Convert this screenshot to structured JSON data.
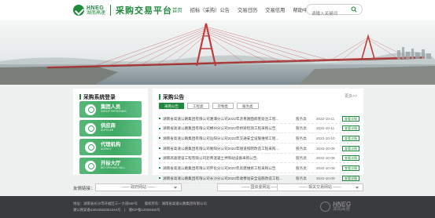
{
  "header": {
    "logo_en": "HNEG",
    "logo_cn": "湖南高速",
    "site_title": "采购交易平台",
    "nav": [
      "首页",
      "招标（采购）公告",
      "交易日历",
      "交易信用",
      "帮助中心"
    ],
    "search_placeholder": "请输入关键词"
  },
  "login_panel": {
    "title": "采购系统登录",
    "buttons": [
      {
        "label": "集团人员",
        "sub": "GROUP PERSONNEL"
      },
      {
        "label": "供应商",
        "sub": "SUPPLIER"
      },
      {
        "label": "代理机构",
        "sub": "AGENCY"
      },
      {
        "label": "开标大厅",
        "sub": "BID OPENING HALL"
      }
    ]
  },
  "announcements": {
    "title": "采购公告",
    "more": "更多>>",
    "tabs": [
      "采购公告",
      "工程类",
      "货物类",
      "服务类"
    ],
    "rows": [
      {
        "title": "湖南省高速公路集团有限公司湘潭分公司2022年沥青路面病害处治工程...",
        "type": "服务类",
        "date": "2022-10-11",
        "action": "查看详情"
      },
      {
        "title": "湖南省高速公路集团有限公司郴州分公司2022年桥梁检测工程采购公告",
        "type": "服务类",
        "date": "2022-10-11",
        "action": "查看详情"
      },
      {
        "title": "湖南省高速公路集团有限公司岳阳分公司2022年交通安全设施维修工程...",
        "type": "服务类",
        "date": "2022-10-10",
        "action": "查看详情"
      },
      {
        "title": "湖南省高速公路集团有限公司衡阳分公司2022年隧道照明改造工程采购...",
        "type": "服务类",
        "date": "2022-10-09",
        "action": "查看详情"
      },
      {
        "title": "湖南高速建设工程有限公司沥青混凝土拌和站设备采购公告",
        "type": "服务类",
        "date": "2022-10-09",
        "action": "查看详情"
      },
      {
        "title": "湖南省高速公路集团有限公司怀化分公司2022年房建维修工程采购公告",
        "type": "服务类",
        "date": "2022-10-09",
        "action": "查看详情"
      },
      {
        "title": "湖南省高速公路集团有限公司长沙分公司2022年收费站安全设施改造工程...",
        "type": "服务类",
        "date": "2022-10-09",
        "action": "查看详情"
      }
    ]
  },
  "friend_links": {
    "label": "友情链接：",
    "selects": [
      "—— 政府网站 ——",
      "—— 国资委网站 ——",
      "—— 相关交易网站 ——"
    ]
  },
  "footer": {
    "line1": "地址：湖南省长沙市开福区三一大道500号　　版权所有：湖南省高速公路集团有限公司",
    "line2": "湘公网安备43010502001044号　|　湘ICP备12008450号",
    "logo_en": "HNEG",
    "logo_cn": "湖南高速"
  },
  "colors": {
    "brand_green": "#1f8a3e",
    "button_green": "#3fa863",
    "footer_bg": "#3a3b3d"
  }
}
